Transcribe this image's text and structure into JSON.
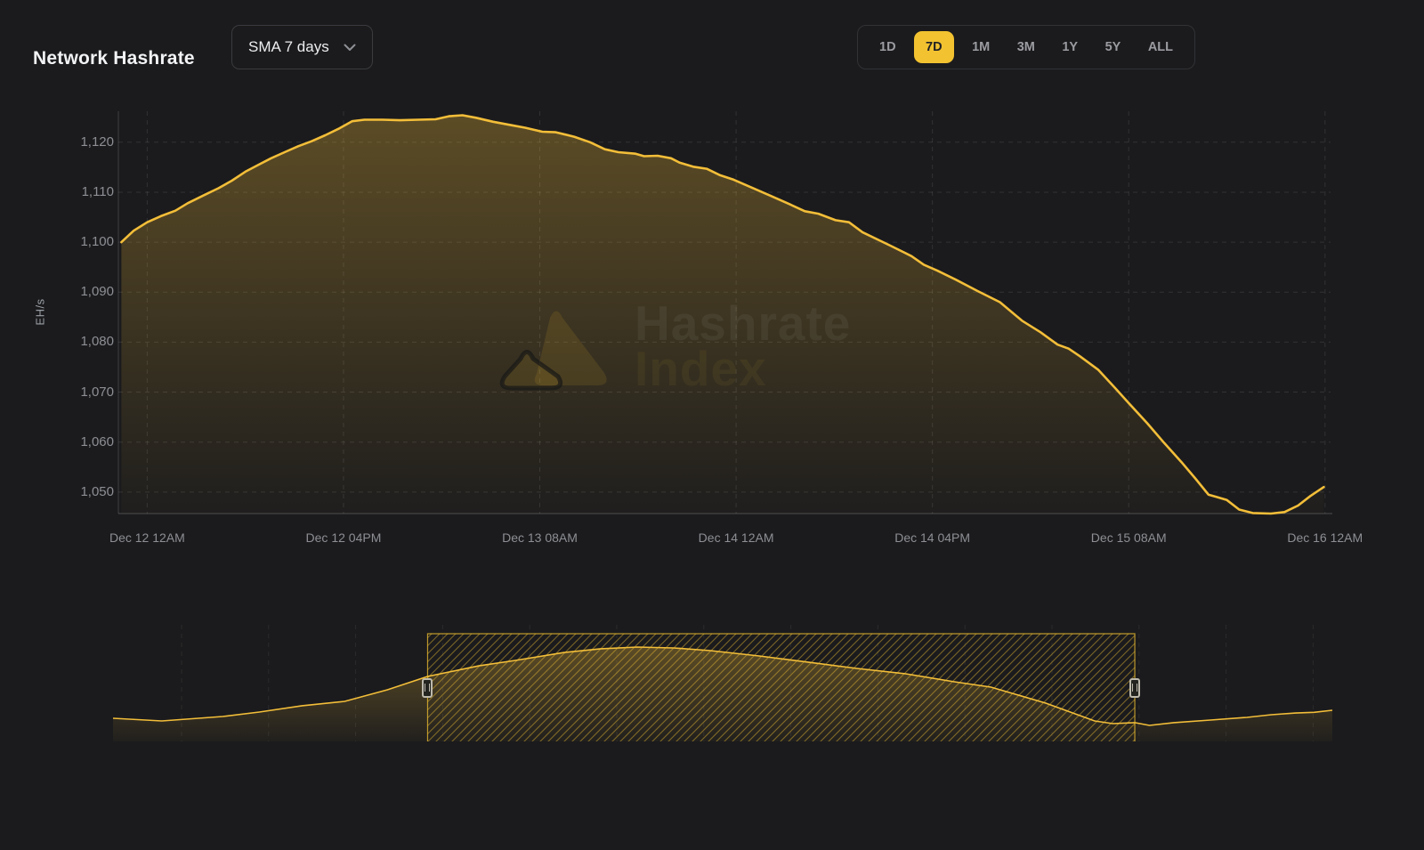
{
  "header": {
    "title": "Network Hashrate",
    "sma_dropdown": {
      "value": "SMA 7 days"
    },
    "ranges": [
      {
        "label": "1D",
        "active": false
      },
      {
        "label": "7D",
        "active": true
      },
      {
        "label": "1M",
        "active": false
      },
      {
        "label": "3M",
        "active": false
      },
      {
        "label": "1Y",
        "active": false
      },
      {
        "label": "5Y",
        "active": false
      },
      {
        "label": "ALL",
        "active": false
      }
    ]
  },
  "watermark": {
    "line1": "Hashrate",
    "line2": "Index"
  },
  "colors": {
    "background": "#1B1B1D",
    "accent": "#F2C230",
    "line": "#F3BE39",
    "grid": "rgba(255,255,255,0.10)",
    "nav_grid": "rgba(255,255,255,0.07)",
    "axis_line": "rgba(255,255,255,0.16)",
    "tick_text": "#8D8F94",
    "hatch": "rgba(242,194,48,0.45)",
    "selection_border": "rgba(242,194,48,0.75)"
  },
  "chart_data": {
    "type": "area",
    "title": "Network Hashrate",
    "ylabel": "EH/s",
    "ylim": [
      1045.7,
      1126.2
    ],
    "xlim_hours": [
      -2.35,
      96.45
    ],
    "grid": "dashed",
    "yticks": [
      1050,
      1060,
      1070,
      1080,
      1090,
      1100,
      1110,
      1120
    ],
    "xticks": [
      {
        "t": 0,
        "label": "Dec 12 12AM"
      },
      {
        "t": 16,
        "label": "Dec 12 04PM"
      },
      {
        "t": 32,
        "label": "Dec 13 08AM"
      },
      {
        "t": 48,
        "label": "Dec 14 12AM"
      },
      {
        "t": 64,
        "label": "Dec 14 04PM"
      },
      {
        "t": 80,
        "label": "Dec 15 08AM"
      },
      {
        "t": 96,
        "label": "Dec 16 12AM"
      }
    ],
    "series": [
      {
        "points": [
          [
            -2.1,
            1100
          ],
          [
            -1.1,
            1102.3
          ],
          [
            0,
            1104
          ],
          [
            1.1,
            1105.2
          ],
          [
            2.3,
            1106.3
          ],
          [
            3.3,
            1107.8
          ],
          [
            4.7,
            1109.5
          ],
          [
            5.8,
            1110.8
          ],
          [
            6.9,
            1112.3
          ],
          [
            8.0,
            1114.1
          ],
          [
            9.0,
            1115.4
          ],
          [
            10.1,
            1116.8
          ],
          [
            11.2,
            1118
          ],
          [
            12.3,
            1119.2
          ],
          [
            13.4,
            1120.2
          ],
          [
            14.5,
            1121.4
          ],
          [
            15.6,
            1122.7
          ],
          [
            16.7,
            1124.2
          ],
          [
            17.7,
            1124.5
          ],
          [
            19.2,
            1124.5
          ],
          [
            20.6,
            1124.4
          ],
          [
            22.1,
            1124.5
          ],
          [
            23.5,
            1124.6
          ],
          [
            24.6,
            1125.2
          ],
          [
            25.7,
            1125.4
          ],
          [
            26.8,
            1124.9
          ],
          [
            28.2,
            1124.1
          ],
          [
            29.7,
            1123.4
          ],
          [
            30.8,
            1122.9
          ],
          [
            32.2,
            1122.1
          ],
          [
            33.3,
            1122
          ],
          [
            34.8,
            1121.1
          ],
          [
            36.1,
            1120
          ],
          [
            37.3,
            1118.6
          ],
          [
            38.4,
            1118
          ],
          [
            39.8,
            1117.7
          ],
          [
            40.5,
            1117.2
          ],
          [
            41.6,
            1117.3
          ],
          [
            42.7,
            1116.8
          ],
          [
            43.4,
            1115.9
          ],
          [
            44.5,
            1115.1
          ],
          [
            45.6,
            1114.7
          ],
          [
            46.7,
            1113.4
          ],
          [
            47.8,
            1112.5
          ],
          [
            49.2,
            1111
          ],
          [
            50.7,
            1109.4
          ],
          [
            52.1,
            1107.9
          ],
          [
            53.6,
            1106.2
          ],
          [
            54.7,
            1105.7
          ],
          [
            56.1,
            1104.4
          ],
          [
            57.2,
            1104
          ],
          [
            58.3,
            1102
          ],
          [
            60.5,
            1099.4
          ],
          [
            62.3,
            1097.2
          ],
          [
            63.3,
            1095.5
          ],
          [
            64.4,
            1094.3
          ],
          [
            65.9,
            1092.5
          ],
          [
            67.7,
            1090.2
          ],
          [
            69.5,
            1088
          ],
          [
            71.3,
            1084.3
          ],
          [
            72.8,
            1082
          ],
          [
            74.2,
            1079.5
          ],
          [
            75.1,
            1078.7
          ],
          [
            76.0,
            1077.2
          ],
          [
            77.5,
            1074.5
          ],
          [
            78.9,
            1070.8
          ],
          [
            80.0,
            1067.8
          ],
          [
            81.5,
            1063.8
          ],
          [
            82.9,
            1059.8
          ],
          [
            84.3,
            1056
          ],
          [
            85.4,
            1052.8
          ],
          [
            86.5,
            1049.5
          ],
          [
            87.2,
            1049
          ],
          [
            88.0,
            1048.4
          ],
          [
            89.0,
            1046.5
          ],
          [
            90.1,
            1045.8
          ],
          [
            91.6,
            1045.7
          ],
          [
            92.7,
            1046
          ],
          [
            93.8,
            1047.3
          ],
          [
            94.8,
            1049.2
          ],
          [
            95.9,
            1051
          ]
        ]
      }
    ],
    "navigator": {
      "normalized": true,
      "selection": [
        0.258,
        0.838
      ],
      "points": [
        [
          0.0,
          0.215
        ],
        [
          0.04,
          0.19
        ],
        [
          0.09,
          0.231
        ],
        [
          0.12,
          0.273
        ],
        [
          0.155,
          0.331
        ],
        [
          0.19,
          0.372
        ],
        [
          0.225,
          0.479
        ],
        [
          0.258,
          0.603
        ],
        [
          0.3,
          0.702
        ],
        [
          0.33,
          0.752
        ],
        [
          0.37,
          0.826
        ],
        [
          0.4,
          0.86
        ],
        [
          0.43,
          0.876
        ],
        [
          0.46,
          0.868
        ],
        [
          0.49,
          0.843
        ],
        [
          0.53,
          0.793
        ],
        [
          0.57,
          0.736
        ],
        [
          0.61,
          0.678
        ],
        [
          0.65,
          0.628
        ],
        [
          0.69,
          0.554
        ],
        [
          0.72,
          0.504
        ],
        [
          0.74,
          0.438
        ],
        [
          0.765,
          0.355
        ],
        [
          0.785,
          0.273
        ],
        [
          0.805,
          0.19
        ],
        [
          0.82,
          0.165
        ],
        [
          0.838,
          0.174
        ],
        [
          0.85,
          0.149
        ],
        [
          0.87,
          0.174
        ],
        [
          0.9,
          0.198
        ],
        [
          0.93,
          0.223
        ],
        [
          0.95,
          0.248
        ],
        [
          0.97,
          0.264
        ],
        [
          0.985,
          0.27
        ],
        [
          1.0,
          0.289
        ]
      ]
    }
  }
}
